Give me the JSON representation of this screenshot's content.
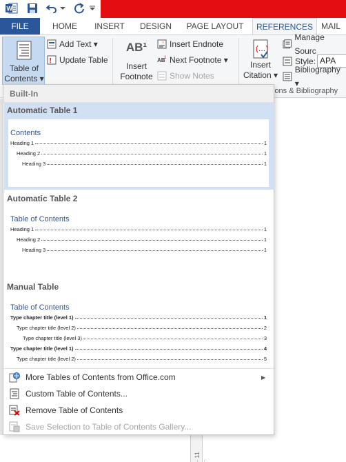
{
  "qat": {
    "icons": [
      "word-icon",
      "save-icon",
      "undo-icon",
      "redo-icon",
      "customize-qat-icon"
    ]
  },
  "tabs": [
    {
      "label": "FILE"
    },
    {
      "label": "HOME"
    },
    {
      "label": "INSERT"
    },
    {
      "label": "DESIGN"
    },
    {
      "label": "PAGE LAYOUT"
    },
    {
      "label": "REFERENCES"
    },
    {
      "label": "MAIL"
    }
  ],
  "ribbon": {
    "toc": {
      "line1": "Table of",
      "line2": "Contents ▾"
    },
    "add_text": "Add Text ▾",
    "update_table": "Update Table",
    "insert_footnote": {
      "line1": "Insert",
      "line2": "Footnote",
      "glyph": "AB¹"
    },
    "insert_endnote": "Insert Endnote",
    "next_footnote": "Next Footnote ▾",
    "show_notes": "Show Notes",
    "insert_citation": {
      "line1": "Insert",
      "line2": "Citation ▾"
    },
    "manage_sources": "Manage Sourc",
    "style_label": "Style:",
    "style_value": "APA",
    "bibliography": "Bibliography ▾",
    "group_citations": "ions & Bibliography"
  },
  "dropdown": {
    "section": "Built-In",
    "items": [
      {
        "title": "Automatic Table 1",
        "heading": "Contents",
        "rows": [
          {
            "text": "Heading 1",
            "page": "1"
          },
          {
            "text": "Heading 2",
            "page": "1"
          },
          {
            "text": "Heading 3",
            "page": "1"
          }
        ]
      },
      {
        "title": "Automatic Table 2",
        "heading": "Table of Contents",
        "rows": [
          {
            "text": "Heading 1",
            "page": "1"
          },
          {
            "text": "Heading 2",
            "page": "1"
          },
          {
            "text": "Heading 3",
            "page": "1"
          }
        ]
      },
      {
        "title": "Manual Table",
        "heading": "Table of Contents",
        "rows": [
          {
            "text": "Type chapter title (level 1)",
            "page": "1"
          },
          {
            "text": "Type chapter title (level 2)",
            "page": "2"
          },
          {
            "text": "Type chapter title (level 3)",
            "page": "3"
          },
          {
            "text": "Type chapter title (level 1)",
            "page": "4"
          },
          {
            "text": "Type chapter title (level 2)",
            "page": "5"
          }
        ]
      }
    ],
    "menu": [
      {
        "label": "More Tables of Contents from Office.com",
        "icon": "office-globe-icon"
      },
      {
        "label": "Custom Table of Contents...",
        "icon": "toc-document-icon"
      },
      {
        "label": "Remove Table of Contents",
        "icon": "remove-toc-icon"
      },
      {
        "label": "Save Selection to Table of Contents Gallery...",
        "icon": "save-selection-icon"
      }
    ]
  },
  "ruler_label": "· 11 ·",
  "colors": {
    "file_tab": "#2b579a",
    "titlebar": "#e30d12",
    "hover_item": "#d1e0f2",
    "toc_heading": "#2e5597"
  }
}
